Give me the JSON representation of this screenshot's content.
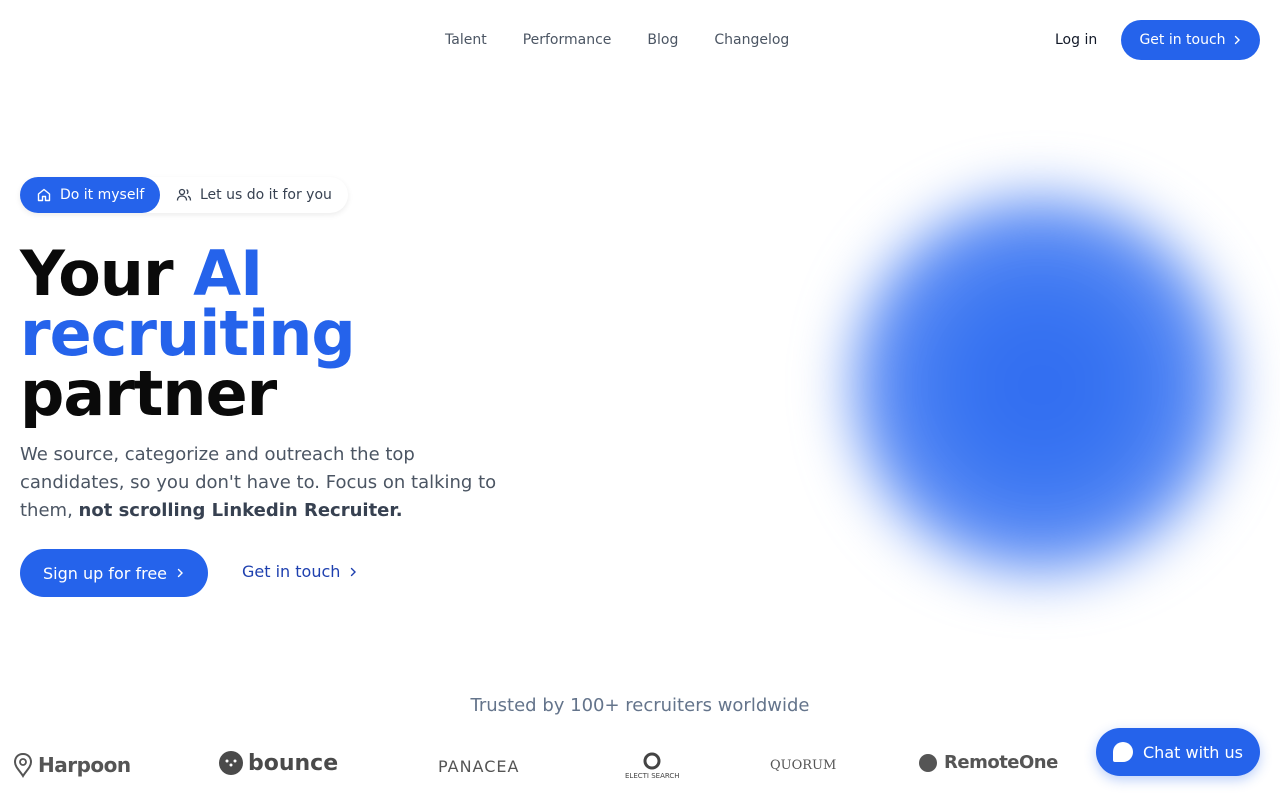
{
  "nav": {
    "links": [
      "Talent",
      "Performance",
      "Blog",
      "Changelog"
    ],
    "login_label": "Log in",
    "cta_label": "Get in touch"
  },
  "hero": {
    "toggle": {
      "active_label": "Do it myself",
      "other_label": "Let us do it for you"
    },
    "headline": {
      "part1": "Your ",
      "part2": "AI",
      "part3": "recruiting",
      "part4": "partner"
    },
    "subtitle": {
      "text": "We source, categorize and outreach the top candidates, so you don't have to. Focus on talking to them, ",
      "bold": "not scrolling Linkedin Recruiter."
    },
    "signup_label": "Sign up for free",
    "touch_label": "Get in touch"
  },
  "trusted": {
    "text": "Trusted by 100+ recruiters worldwide",
    "logos": [
      "Harpoon",
      "bounce",
      "PANACEA",
      "ELECTI SEARCH",
      "QUORUM",
      "RemoteOne"
    ]
  },
  "chat": {
    "label": "Chat with us"
  },
  "colors": {
    "accent": "#2563eb"
  }
}
